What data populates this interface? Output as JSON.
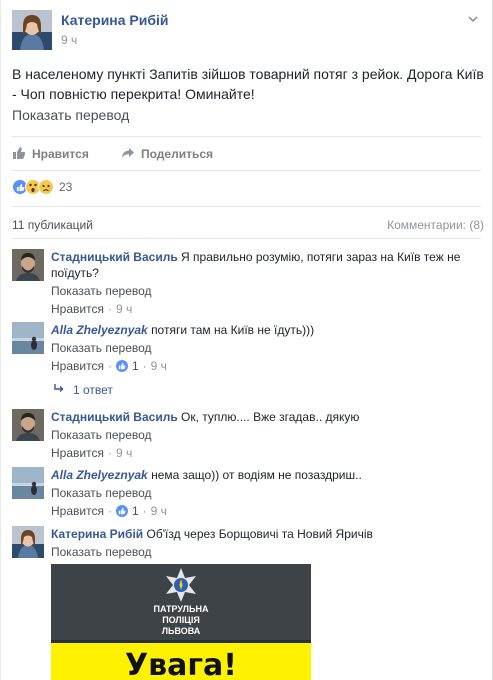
{
  "post": {
    "author": "Катерина Рибій",
    "time": "9 ч",
    "text": "В населеному пункті Запитів зійшов товарний потяг з рейок. Дорога Київ - Чоп повністю перекрита! Оминайте!",
    "translate_link": "Показать перевод"
  },
  "actions": {
    "like_label": "Нравится",
    "share_label": "Поделиться"
  },
  "reactions": {
    "icons": [
      "like-reaction",
      "wow-reaction",
      "sad-reaction"
    ],
    "count": "23"
  },
  "stats": {
    "publications": "11 публикаций",
    "comments": "Комментарии: (8)"
  },
  "comments": [
    {
      "author": "Стадницький Василь",
      "text": "Я правильно розумію, потяги зараз на Київ теж не поїдуть?",
      "translate": "Показать перевод",
      "like_label": "Нравится",
      "time": "9 ч"
    },
    {
      "author": "Alla Zhelyeznyak",
      "text": "потяги там на Київ не їдуть)))",
      "translate": "Показать перевод",
      "like_label": "Нравится",
      "likes": "1",
      "time": "9 ч",
      "replies": "1 ответ"
    },
    {
      "author": "Стадницький Василь",
      "text": "Ок, туплю.... Вже згадав.. дякую",
      "translate": "Показать перевод",
      "like_label": "Нравится",
      "time": "9 ч"
    },
    {
      "author": "Alla Zhelyeznyak",
      "text": "нема защо)) от водіям не позаздриш..",
      "translate": "Показать перевод",
      "like_label": "Нравится",
      "likes": "1",
      "time": "9 ч"
    },
    {
      "author": "Катерина Рибій",
      "text": "Об'їзд через Борщовичі та Новий Яричів",
      "translate": "Показать перевод"
    }
  ],
  "attachment": {
    "caption_line1": "ПАТРУЛЬНА",
    "caption_line2": "ПОЛІЦІЯ",
    "caption_line3": "ЛЬВОВА",
    "alert": "Увага!"
  },
  "colors": {
    "link_blue": "#365899",
    "like_blue": "#5890ff",
    "meta_gray": "#90949c",
    "alert_yellow": "#fff200"
  }
}
